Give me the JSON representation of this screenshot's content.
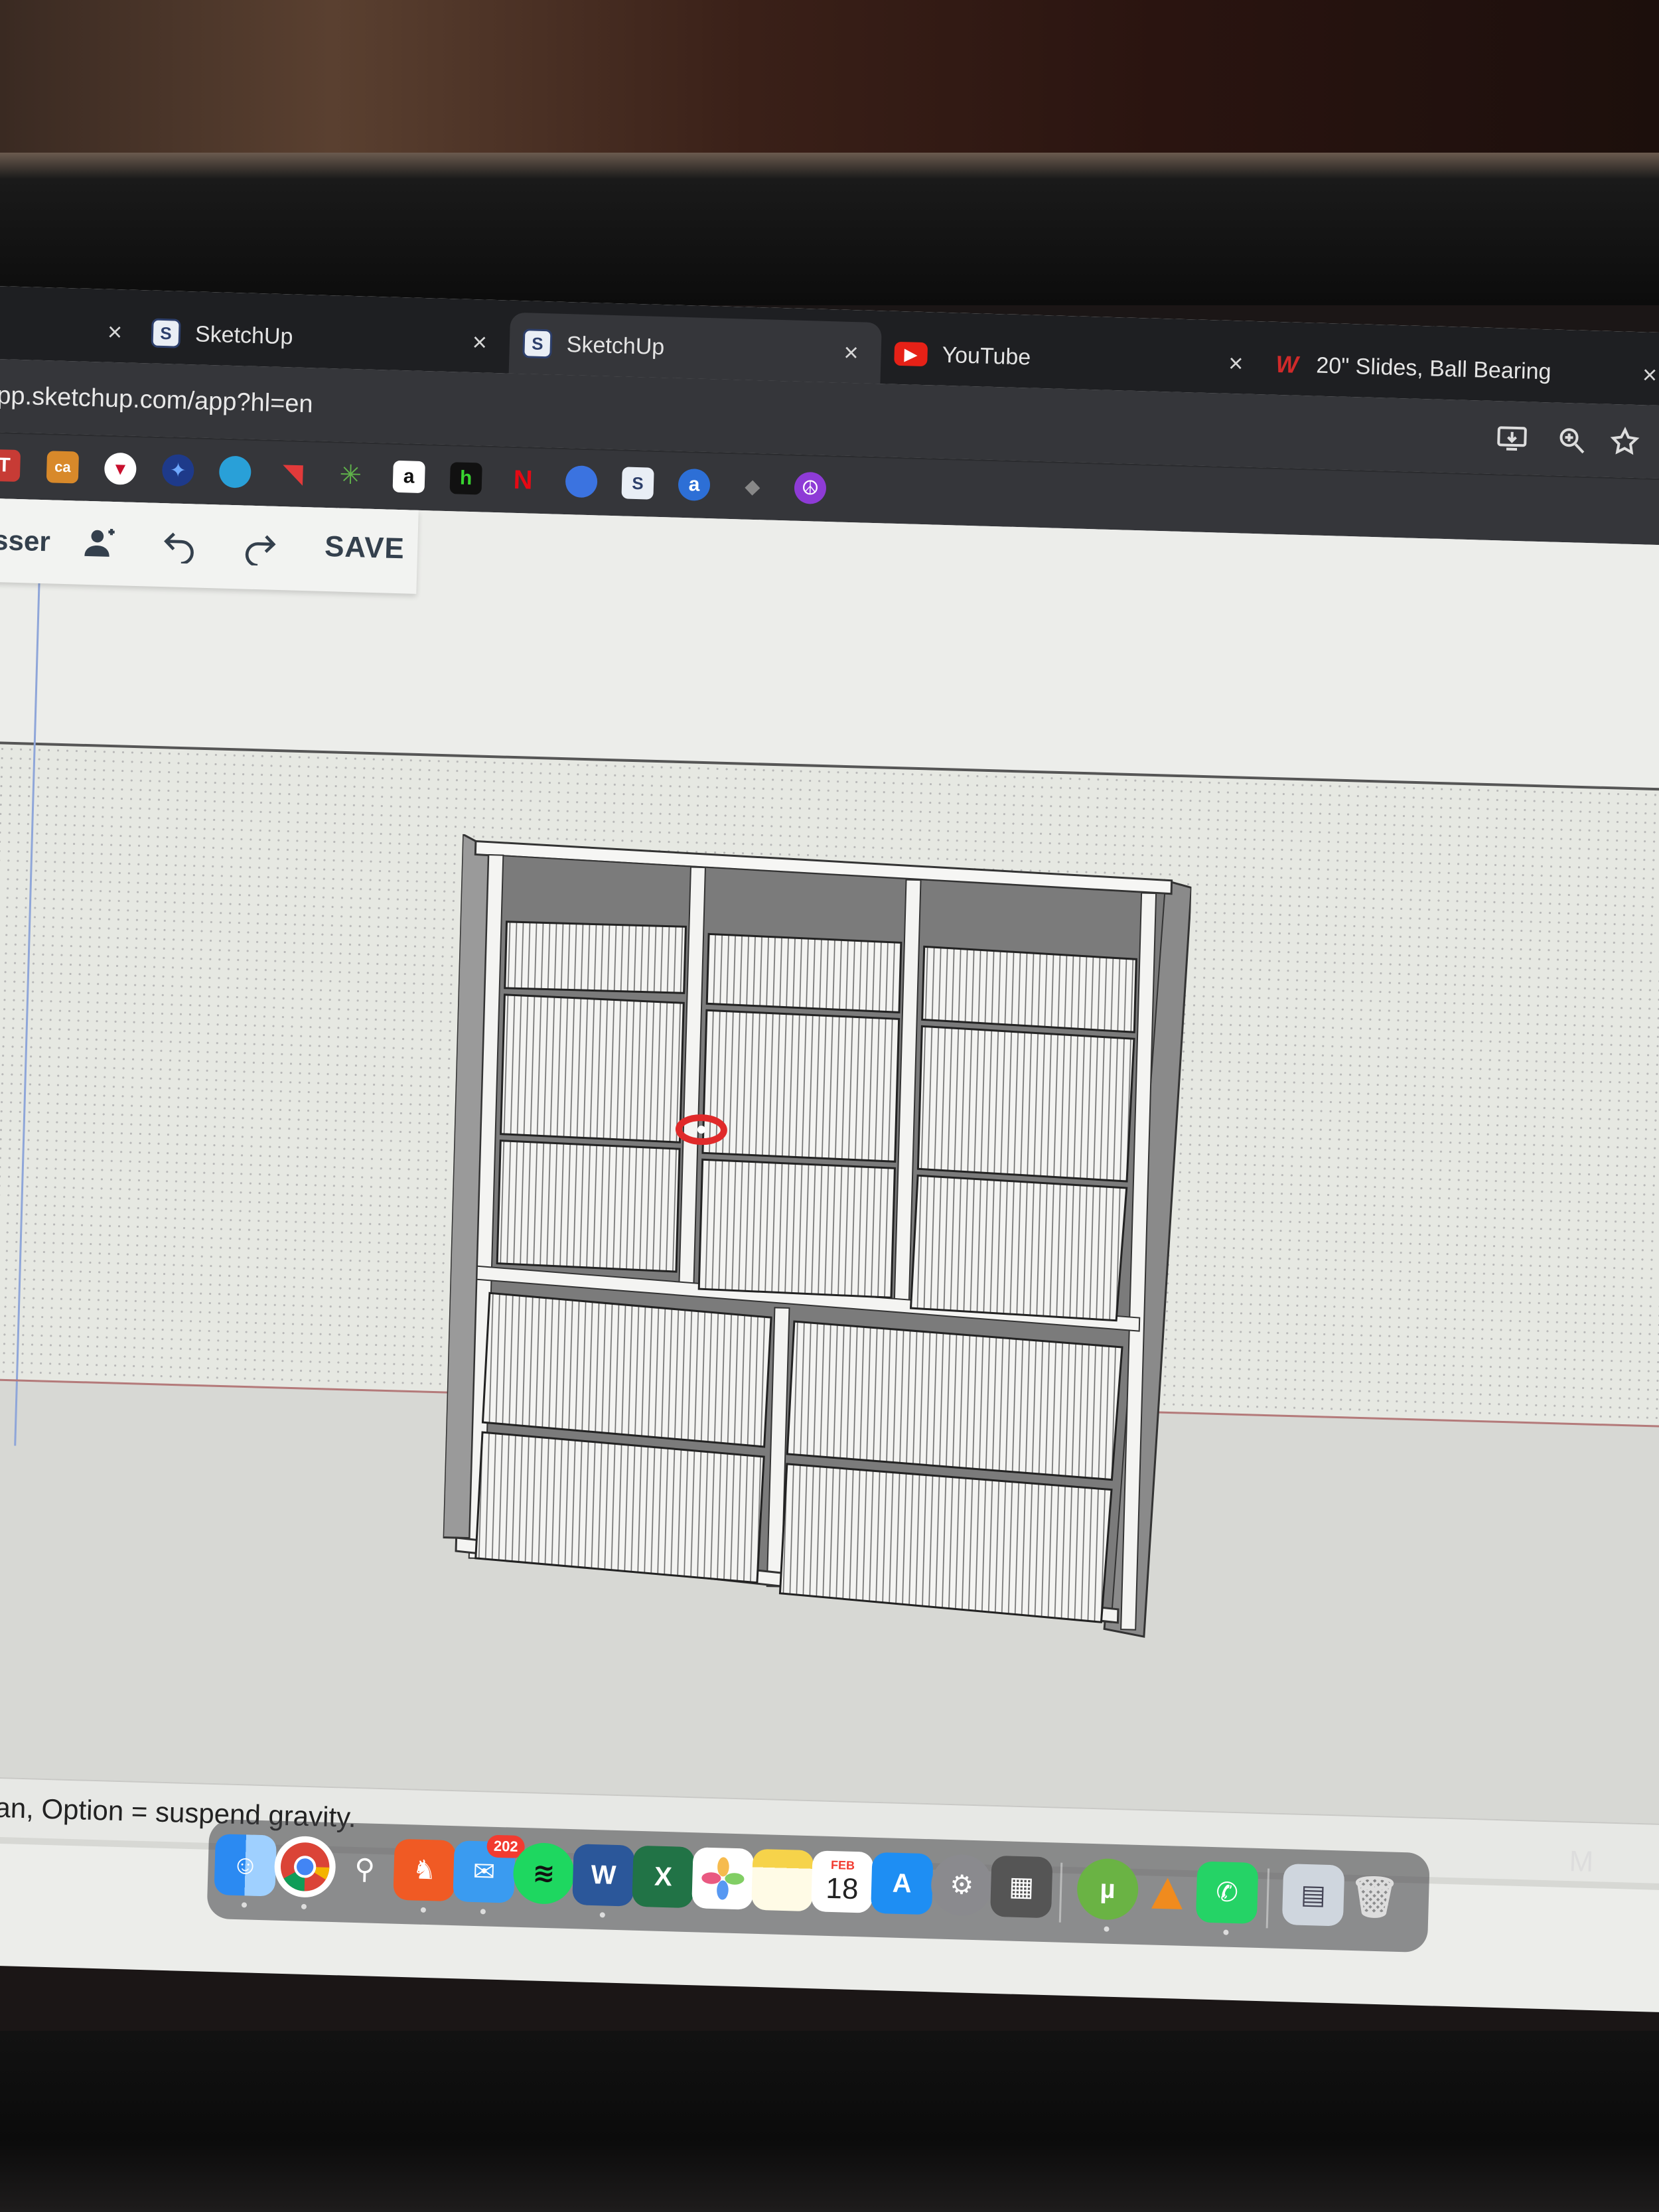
{
  "browser": {
    "tabs": [
      {
        "label": "",
        "close": "×"
      },
      {
        "label": "SketchUp",
        "close": "×"
      },
      {
        "label": "SketchUp",
        "close": "×"
      },
      {
        "label": "YouTube",
        "close": "×"
      },
      {
        "label": "20\" Slides, Ball Bearing",
        "close": "×"
      }
    ],
    "url": "pp.sketchup.com/app?hl=en",
    "bookmarks": [
      "T",
      "ca",
      "",
      "",
      "",
      "",
      "",
      "a",
      "h",
      "N",
      "",
      "",
      "a",
      "",
      ""
    ]
  },
  "sketchup": {
    "toolbar": {
      "user_label": "sser",
      "save_label": "SAVE"
    },
    "status_text": "ift = Pan, Option = suspend gravity."
  },
  "dock": {
    "mail_badge": "202",
    "calendar_month": "FEB",
    "calendar_day": "18",
    "word_glyph": "W",
    "excel_glyph": "X",
    "edge_letter": "M"
  },
  "colors": {
    "tabbar_bg": "#1e1f22",
    "active_tab_bg": "#35363a",
    "youtube_red": "#e62117",
    "sketchup_text": "#34404d"
  }
}
